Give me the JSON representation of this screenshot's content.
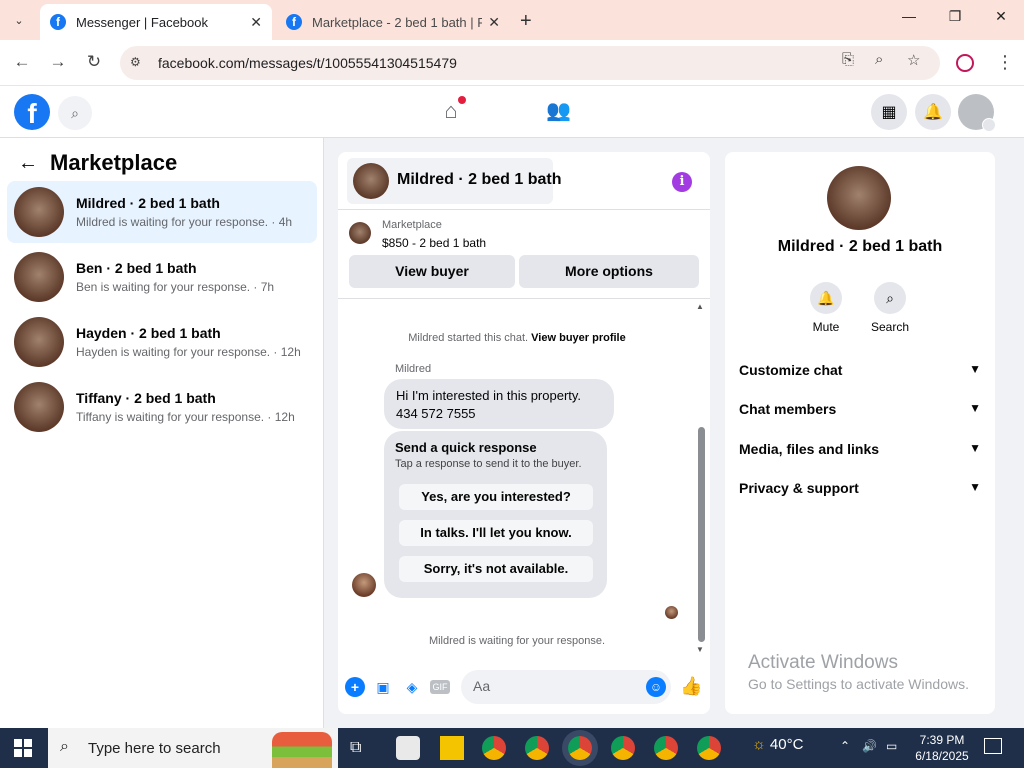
{
  "browser": {
    "tabs": [
      {
        "title": "Messenger | Facebook",
        "active": true
      },
      {
        "title": "Marketplace - 2 bed 1 bath | Facebook",
        "active": false
      }
    ],
    "url": "facebook.com/messages/t/10055541304515479",
    "new_tab_icon": "+",
    "minimize_icon": "—",
    "maximize_icon": "❐",
    "close_icon": "✕"
  },
  "left_panel": {
    "title": "Marketplace",
    "conversations": [
      {
        "name": "Mildred · 2 bed 1 bath",
        "snippet": "Mildred is waiting for your response. · 4h",
        "selected": true
      },
      {
        "name": "Ben · 2 bed 1 bath",
        "snippet": "Ben is waiting for your response. · 7h",
        "selected": false
      },
      {
        "name": "Hayden · 2 bed 1 bath",
        "snippet": "Hayden is waiting for your response. · 12h",
        "selected": false
      },
      {
        "name": "Tiffany · 2 bed 1 bath",
        "snippet": "Tiffany is waiting for your response. · 12h",
        "selected": false
      }
    ]
  },
  "chat": {
    "title": "Mildred · 2 bed 1 bath",
    "listing_category": "Marketplace",
    "listing_price": "$850 - 2 bed 1 bath",
    "view_buyer_label": "View buyer",
    "more_options_label": "More options",
    "started_text": "Mildred started this chat.",
    "view_buyer_profile_label": "View buyer profile",
    "sender_name": "Mildred",
    "message_line1": "Hi I'm interested in this property.",
    "message_line2": "434 572 7555",
    "quick_title": "Send a quick response",
    "quick_subtitle": "Tap a response to send it to the buyer.",
    "quick_replies": [
      "Yes, are you interested?",
      "In talks. I'll let you know.",
      "Sorry, it's not available."
    ],
    "waiting_text": "Mildred is waiting for your response.",
    "composer_placeholder": "Aa",
    "gif_label": "GIF"
  },
  "right_panel": {
    "name": "Mildred · 2 bed 1 bath",
    "mute_label": "Mute",
    "search_label": "Search",
    "sections": [
      "Customize chat",
      "Chat members",
      "Media, files and links",
      "Privacy & support"
    ]
  },
  "watermark": {
    "line1": "Activate Windows",
    "line2": "Go to Settings to activate Windows."
  },
  "taskbar": {
    "search_placeholder": "Type here to search",
    "weather": "40°C",
    "time": "7:39 PM",
    "date": "6/18/2025"
  },
  "colors": {
    "facebook_blue": "#1877f2",
    "messenger_blue": "#0a7cff",
    "info_purple": "#a33be3",
    "selected_row": "#e7f3ff",
    "tab_strip": "#fbe3dc",
    "taskbar": "#1f2f49"
  }
}
